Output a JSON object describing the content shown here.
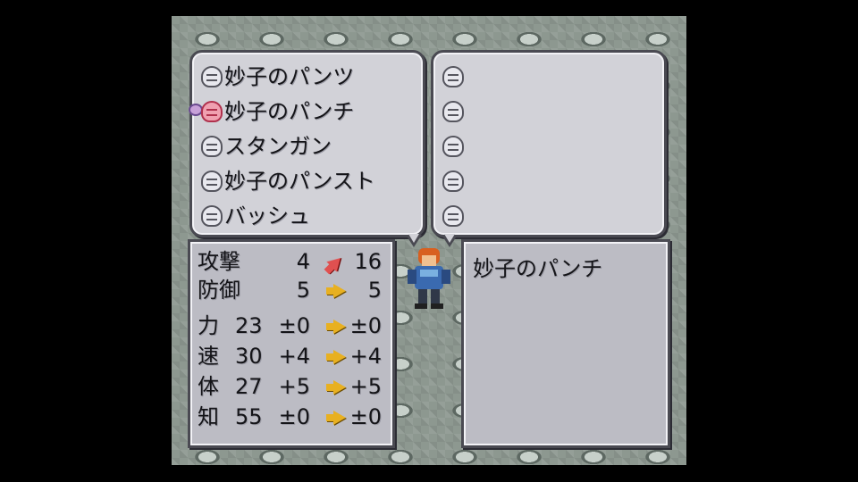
{
  "items_list": [
    {
      "label": "妙子のパンツ",
      "selected": false
    },
    {
      "label": "妙子のパンチ",
      "selected": true
    },
    {
      "label": "スタンガン",
      "selected": false
    },
    {
      "label": "妙子のパンスト",
      "selected": false
    },
    {
      "label": "バッシュ",
      "selected": false
    }
  ],
  "equip_slots": [
    {
      "icon": "empty-slot-icon"
    },
    {
      "icon": "empty-slot-icon"
    },
    {
      "icon": "empty-slot-icon"
    },
    {
      "icon": "empty-slot-icon"
    },
    {
      "icon": "empty-slot-icon"
    }
  ],
  "stats": [
    {
      "name": "攻撃",
      "base": "",
      "current": "4",
      "arrow": "up",
      "new": "16"
    },
    {
      "name": "防御",
      "base": "",
      "current": "5",
      "arrow": "right",
      "new": "5"
    },
    {
      "name": "力",
      "base": "23",
      "current": "±0",
      "arrow": "right",
      "new": "±0"
    },
    {
      "name": "速",
      "base": "30",
      "current": "+4",
      "arrow": "right",
      "new": "+4"
    },
    {
      "name": "体",
      "base": "27",
      "current": "+5",
      "arrow": "right",
      "new": "+5"
    },
    {
      "name": "知",
      "base": "55",
      "current": "±0",
      "arrow": "right",
      "new": "±0"
    }
  ],
  "description": {
    "text": "妙子のパンチ"
  },
  "colors": {
    "panel": "#d2d2d8",
    "border": "#4a4a52",
    "arrow_up": "#e05050",
    "arrow_right": "#e8b020",
    "selected_item": "#f0a0b0"
  }
}
